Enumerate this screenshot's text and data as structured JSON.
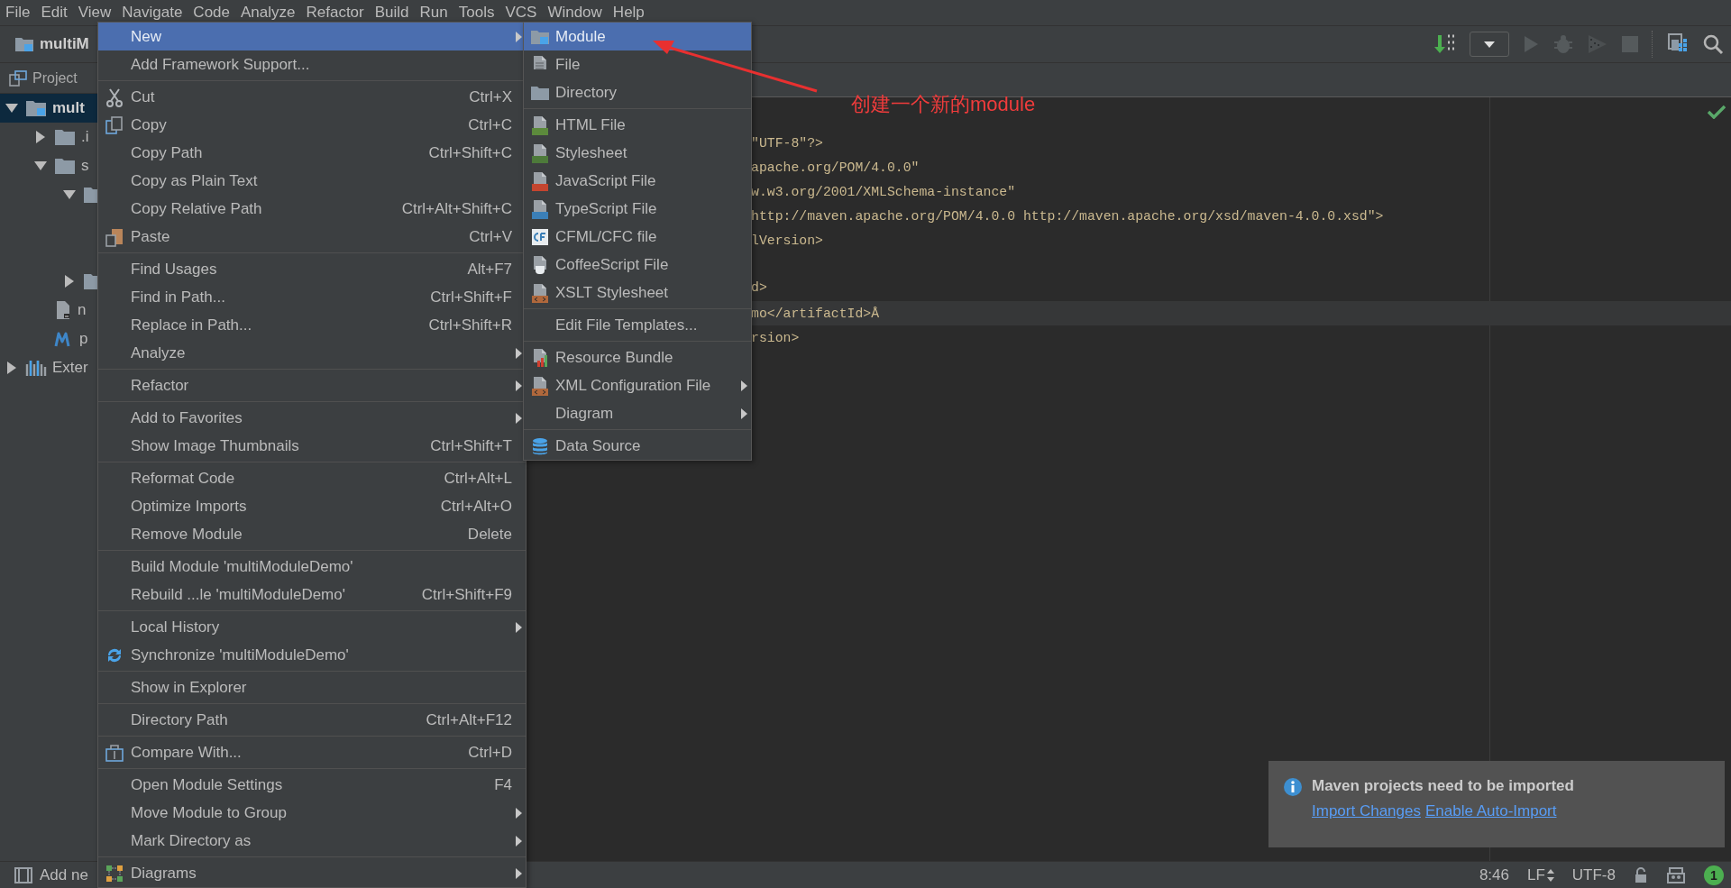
{
  "menu_bar": [
    {
      "label": "File"
    },
    {
      "label": "Edit"
    },
    {
      "label": "View"
    },
    {
      "label": "Navigate"
    },
    {
      "label": "Code"
    },
    {
      "label": "Analyze"
    },
    {
      "label": "Refactor"
    },
    {
      "label": "Build"
    },
    {
      "label": "Run"
    },
    {
      "label": "Tools"
    },
    {
      "label": "VCS"
    },
    {
      "label": "Window"
    },
    {
      "label": "Help"
    }
  ],
  "navigation_bar": {
    "breadcrumb": "multiM"
  },
  "project_panel": {
    "title": "Project",
    "tree": [
      {
        "label": "mult",
        "kind": "module",
        "expanded": true,
        "selected": true,
        "children": [
          {
            "label": ".i",
            "kind": "folder",
            "expanded": false,
            "selected": false
          },
          {
            "label": "s",
            "kind": "folder",
            "expanded": true,
            "selected": false,
            "children": [
              {
                "kind": "folder",
                "expanded": true,
                "selected": false
              },
              {
                "kind": "folder",
                "expanded": false,
                "selected": false
              }
            ]
          },
          {
            "label": "n",
            "kind": "file",
            "selected": false
          },
          {
            "label": "p",
            "kind": "maven",
            "selected": false
          }
        ]
      },
      {
        "label": "Exter",
        "kind": "library",
        "expanded": false,
        "selected": false
      }
    ]
  },
  "editor": {
    "lines": [
      {
        "text": "\"UTF-8\"?>",
        "current": false
      },
      {
        "text": "apache.org/POM/4.0.0\"",
        "current": false
      },
      {
        "text": "w.w3.org/2001/XMLSchema-instance\"",
        "current": false
      },
      {
        "text": "http://maven.apache.org/POM/4.0.0 http://maven.apache.org/xsd/maven-4.0.0.xsd\">",
        "current": false
      },
      {
        "text": "lVersion>",
        "current": false
      },
      {
        "text": "d>",
        "current": false,
        "blank_line_before": true
      },
      {
        "text": "mo</artifactId>Å",
        "current": true
      },
      {
        "text": "rsion>",
        "current": false
      }
    ]
  },
  "context_menu": {
    "groups": [
      [
        {
          "label": "New",
          "kind": "plain",
          "submenu": true,
          "selected": true
        },
        {
          "label": "Add Framework Support...",
          "kind": "plain",
          "submenu": false,
          "selected": false
        }
      ],
      [
        {
          "label": "Cut",
          "shortcut": "Ctrl+X",
          "kind": "cut",
          "submenu": false,
          "selected": false
        },
        {
          "label": "Copy",
          "shortcut": "Ctrl+C",
          "kind": "copy",
          "submenu": false,
          "selected": false
        },
        {
          "label": "Copy Path",
          "shortcut": "Ctrl+Shift+C",
          "kind": "plain",
          "submenu": false,
          "selected": false
        },
        {
          "label": "Copy as Plain Text",
          "kind": "plain",
          "submenu": false,
          "selected": false
        },
        {
          "label": "Copy Relative Path",
          "shortcut": "Ctrl+Alt+Shift+C",
          "kind": "plain",
          "submenu": false,
          "selected": false
        },
        {
          "label": "Paste",
          "shortcut": "Ctrl+V",
          "kind": "paste",
          "submenu": false,
          "selected": false
        }
      ],
      [
        {
          "label": "Find Usages",
          "shortcut": "Alt+F7",
          "kind": "plain",
          "submenu": false,
          "selected": false
        },
        {
          "label": "Find in Path...",
          "shortcut": "Ctrl+Shift+F",
          "kind": "plain",
          "submenu": false,
          "selected": false
        },
        {
          "label": "Replace in Path...",
          "shortcut": "Ctrl+Shift+R",
          "kind": "plain",
          "submenu": false,
          "selected": false
        },
        {
          "label": "Analyze",
          "kind": "plain",
          "submenu": true,
          "selected": false
        }
      ],
      [
        {
          "label": "Refactor",
          "kind": "plain",
          "submenu": true,
          "selected": false
        }
      ],
      [
        {
          "label": "Add to Favorites",
          "kind": "plain",
          "submenu": true,
          "selected": false
        },
        {
          "label": "Show Image Thumbnails",
          "shortcut": "Ctrl+Shift+T",
          "kind": "plain",
          "submenu": false,
          "selected": false
        }
      ],
      [
        {
          "label": "Reformat Code",
          "shortcut": "Ctrl+Alt+L",
          "kind": "plain",
          "submenu": false,
          "selected": false
        },
        {
          "label": "Optimize Imports",
          "shortcut": "Ctrl+Alt+O",
          "kind": "plain",
          "submenu": false,
          "selected": false
        },
        {
          "label": "Remove Module",
          "shortcut": "Delete",
          "kind": "plain",
          "submenu": false,
          "selected": false
        }
      ],
      [
        {
          "label": "Build Module 'multiModuleDemo'",
          "kind": "plain",
          "submenu": false,
          "selected": false
        },
        {
          "label": "Rebuild ...le 'multiModuleDemo'",
          "shortcut": "Ctrl+Shift+F9",
          "kind": "plain",
          "submenu": false,
          "selected": false
        }
      ],
      [
        {
          "label": "Local History",
          "kind": "plain",
          "submenu": true,
          "selected": false
        },
        {
          "label": "Synchronize 'multiModuleDemo'",
          "kind": "sync",
          "submenu": false,
          "selected": false
        }
      ],
      [
        {
          "label": "Show in Explorer",
          "kind": "plain",
          "submenu": false,
          "selected": false
        }
      ],
      [
        {
          "label": "Directory Path",
          "shortcut": "Ctrl+Alt+F12",
          "kind": "plain",
          "submenu": false,
          "selected": false
        }
      ],
      [
        {
          "label": "Compare With...",
          "shortcut": "Ctrl+D",
          "kind": "compare",
          "submenu": false,
          "selected": false
        }
      ],
      [
        {
          "label": "Open Module Settings",
          "shortcut": "F4",
          "kind": "plain",
          "submenu": false,
          "selected": false
        },
        {
          "label": "Move Module to Group",
          "kind": "plain",
          "submenu": true,
          "selected": false
        },
        {
          "label": "Mark Directory as",
          "kind": "plain",
          "submenu": true,
          "selected": false
        }
      ],
      [
        {
          "label": "Diagrams",
          "kind": "diagrams",
          "submenu": true,
          "selected": false
        }
      ]
    ]
  },
  "new_submenu": {
    "groups": [
      [
        {
          "label": "Module",
          "kind": "module",
          "submenu": false,
          "selected": true
        },
        {
          "label": "File",
          "kind": "file",
          "submenu": false,
          "selected": false
        },
        {
          "label": "Directory",
          "kind": "directory",
          "submenu": false,
          "selected": false
        }
      ],
      [
        {
          "label": "HTML File",
          "kind": "html",
          "submenu": false,
          "selected": false
        },
        {
          "label": "Stylesheet",
          "kind": "css",
          "submenu": false,
          "selected": false
        },
        {
          "label": "JavaScript File",
          "kind": "js",
          "submenu": false,
          "selected": false
        },
        {
          "label": "TypeScript File",
          "kind": "ts",
          "submenu": false,
          "selected": false
        },
        {
          "label": "CFML/CFC file",
          "kind": "cfml",
          "submenu": false,
          "selected": false
        },
        {
          "label": "CoffeeScript File",
          "kind": "coffee",
          "submenu": false,
          "selected": false
        },
        {
          "label": "XSLT Stylesheet",
          "kind": "xslt",
          "submenu": false,
          "selected": false
        }
      ],
      [
        {
          "label": "Edit File Templates...",
          "kind": "plain",
          "submenu": false,
          "selected": false
        }
      ],
      [
        {
          "label": "Resource Bundle",
          "kind": "bundle",
          "submenu": false,
          "selected": false
        },
        {
          "label": "XML Configuration File",
          "kind": "xml",
          "submenu": true,
          "selected": false
        },
        {
          "label": "Diagram",
          "kind": "plain",
          "submenu": true,
          "selected": false
        }
      ],
      [
        {
          "label": "Data Source",
          "kind": "datasource",
          "submenu": false,
          "selected": false
        }
      ]
    ]
  },
  "annotation": {
    "text": "创建一个新的module"
  },
  "notification": {
    "title": "Maven projects need to be imported",
    "links": [
      "Import Changes",
      "Enable Auto-Import"
    ]
  },
  "status_bar": {
    "message": "Add ne",
    "position": "8:46",
    "line_separator": "LF",
    "encoding": "UTF-8",
    "notifications": "1"
  }
}
